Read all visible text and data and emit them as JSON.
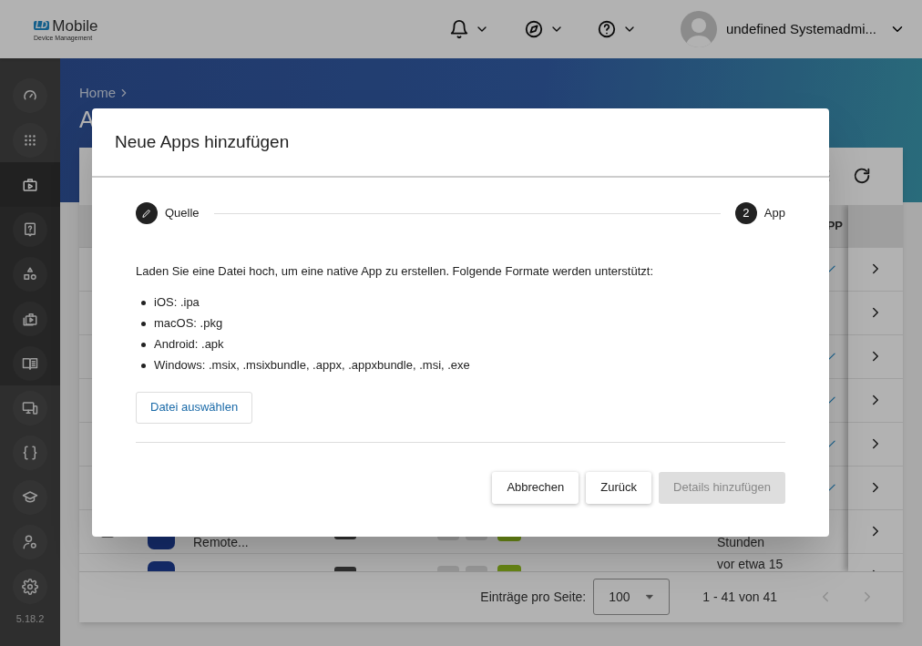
{
  "header": {
    "logo": {
      "badge": "LD",
      "name": "Mobile",
      "tagline": "Device Management"
    },
    "user_name": "undefined Systemadmi..."
  },
  "sidebar": {
    "items": [
      {
        "kind": "main",
        "selected": false
      },
      {
        "kind": "main",
        "selected": false
      },
      {
        "kind": "sub",
        "selected": true
      },
      {
        "kind": "sub",
        "selected": false
      },
      {
        "kind": "sub",
        "selected": false
      },
      {
        "kind": "sub",
        "selected": false
      },
      {
        "kind": "sub",
        "selected": false
      },
      {
        "kind": "main",
        "selected": false
      },
      {
        "kind": "main",
        "selected": false
      },
      {
        "kind": "main",
        "selected": false
      },
      {
        "kind": "main",
        "selected": false
      },
      {
        "kind": "main",
        "selected": false
      }
    ],
    "version": "5.18.2"
  },
  "page": {
    "breadcrumb": "Home",
    "title": "A"
  },
  "table": {
    "column_header": "PP",
    "rows": [
      {
        "flag": true
      },
      {
        "flag": false
      },
      {
        "flag": true
      },
      {
        "flag": true
      },
      {
        "flag": true
      },
      {
        "flag": true
      },
      {
        "flag": false,
        "checked": false,
        "name": "Remote...",
        "age": "Stunden"
      },
      {
        "flag": false,
        "age": "vor etwa 15"
      }
    ],
    "pagination": {
      "label": "Einträge pro Seite:",
      "page_size": "100",
      "range": "1 - 41 von 41"
    }
  },
  "dialog": {
    "title": "Neue Apps hinzufügen",
    "steps": [
      {
        "label": "Quelle",
        "completed": true
      },
      {
        "label": "App",
        "number": "2",
        "completed": false
      }
    ],
    "intro": "Laden Sie eine Datei hoch, um eine native App zu erstellen. Folgende Formate werden unterstützt:",
    "formats": [
      "iOS: .ipa",
      "macOS: .pkg",
      "Android: .apk",
      "Windows: .msix, .msixbundle, .appx, .appxbundle, .msi, .exe"
    ],
    "choose_button": "Datei auswählen",
    "buttons": [
      {
        "label": "Abbrechen",
        "disabled": false
      },
      {
        "label": "Zurück",
        "disabled": false
      },
      {
        "label": "Details hinzufügen",
        "disabled": true
      }
    ]
  }
}
